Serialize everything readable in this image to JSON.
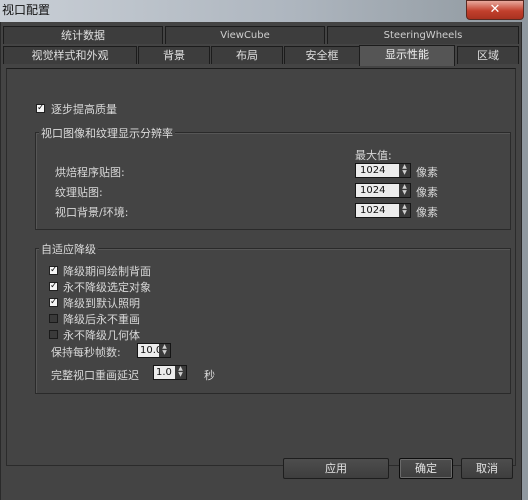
{
  "window": {
    "title": "视口配置",
    "close_label": "✕"
  },
  "tabs_row1": [
    "统计数据",
    "ViewCube",
    "SteeringWheels"
  ],
  "tabs_row2": [
    "视觉样式和外观",
    "背景",
    "布局",
    "安全框",
    "显示性能",
    "区域"
  ],
  "active_tab": "显示性能",
  "progressive": {
    "label": "逐步提高质量",
    "checked": true
  },
  "resolution": {
    "title": "视口图像和纹理显示分辨率",
    "max_label": "最大值:",
    "unit": "像素",
    "rows": [
      {
        "label": "烘焙程序贴图:",
        "value": "1024"
      },
      {
        "label": "纹理贴图:",
        "value": "1024"
      },
      {
        "label": "视口背景/环境:",
        "value": "1024"
      }
    ]
  },
  "adaptive": {
    "title": "自适应降级",
    "items": [
      {
        "label": "降级期间绘制背面",
        "checked": true
      },
      {
        "label": "永不降级选定对象",
        "checked": true
      },
      {
        "label": "降级到默认照明",
        "checked": true
      },
      {
        "label": "降级后永不重画",
        "checked": false
      },
      {
        "label": "永不降级几何体",
        "checked": false
      }
    ],
    "fps_label": "保持每秒帧数:",
    "fps_value": "10.0",
    "delay_label": "完整视口重画延迟",
    "delay_value": "1.0",
    "delay_unit": "秒"
  },
  "buttons": {
    "apply": "应用",
    "ok": "确定",
    "cancel": "取消"
  }
}
